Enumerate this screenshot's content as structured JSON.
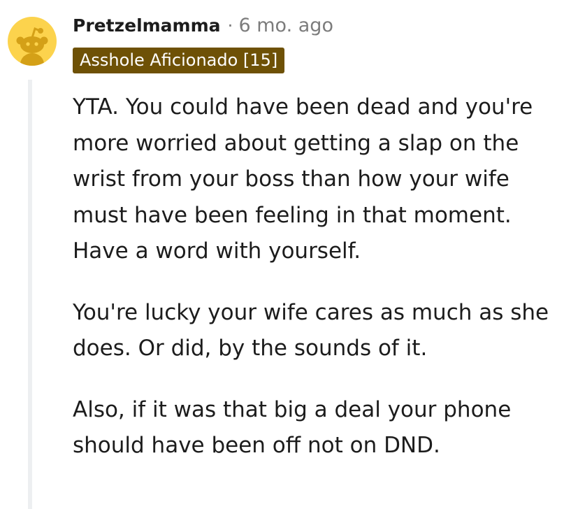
{
  "comment": {
    "username": "Pretzelmamma",
    "separator": "·",
    "timestamp": "6 mo. ago",
    "flair": "Asshole Aficionado [15]",
    "paragraphs": [
      "YTA. You could have been dead and you're more worried about getting a slap on the wrist from your boss than how your wife must have been feeling in that moment. Have a word with yourself.",
      "You're lucky your wife cares as much as she does. Or did, by the sounds of it.",
      "Also, if it was that big a deal your phone should have been off not on DND."
    ]
  },
  "colors": {
    "avatar_bg": "#fcd34d",
    "snoo": "#d4a017",
    "flair_bg": "#6e5106",
    "flair_text": "#ffffff",
    "meta_text": "#7c7c7c",
    "thread_line": "#edeff1"
  },
  "icons": {
    "avatar": "snoo-avatar-icon"
  }
}
